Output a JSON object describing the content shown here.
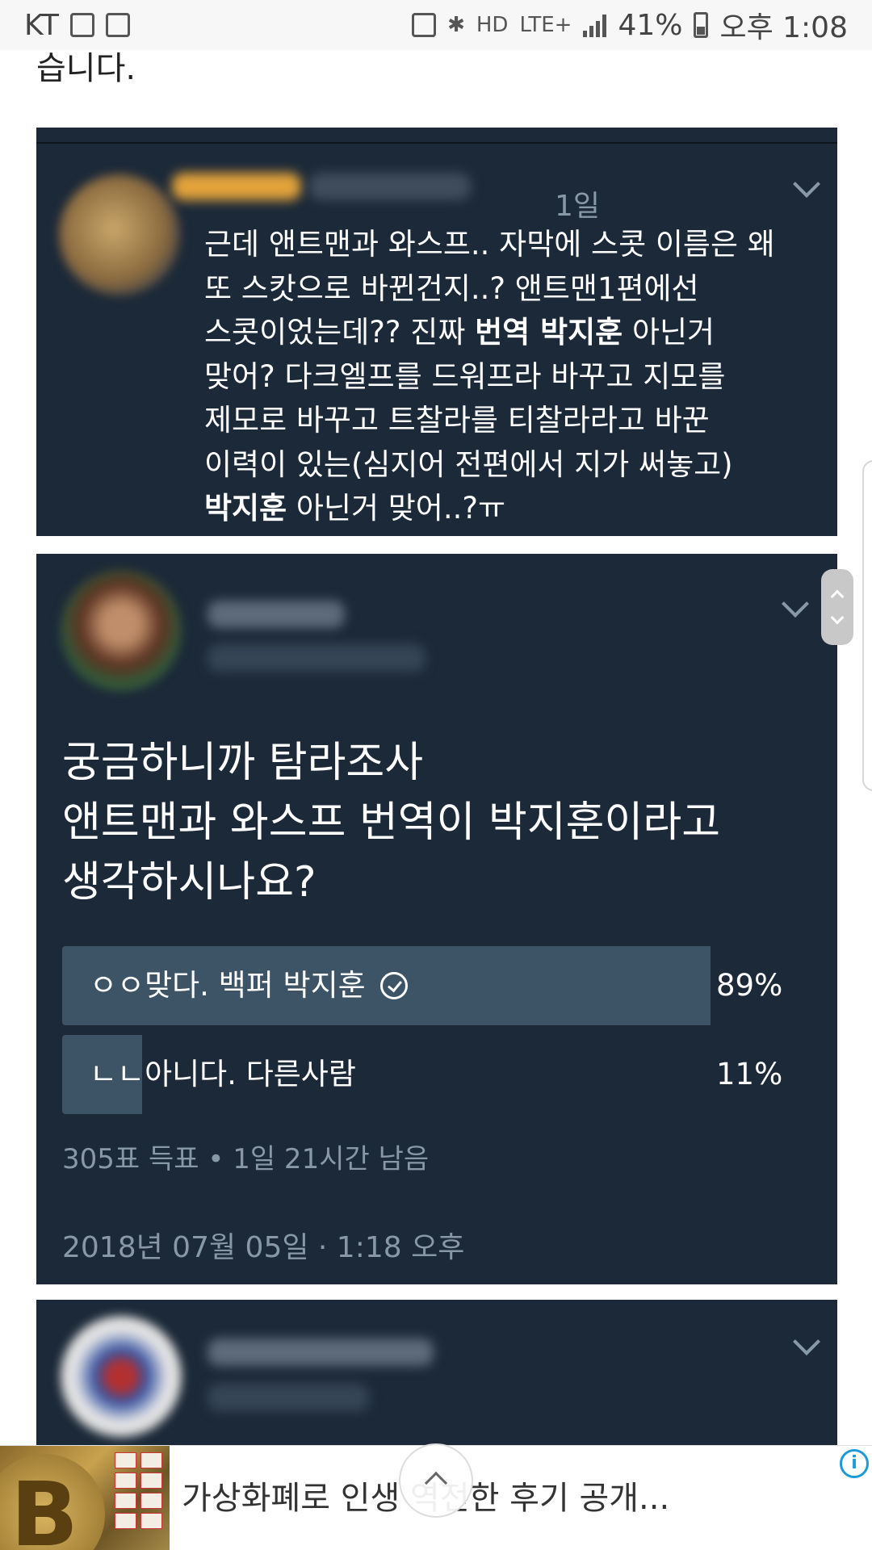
{
  "status_bar": {
    "carrier": "KT",
    "network": "LTE+",
    "hd_label": "HD",
    "battery": "41%",
    "time": "오후 1:08"
  },
  "top_text": "습니다.",
  "tweet1": {
    "time": "1일",
    "lines": [
      {
        "text": "근데 앤트맨과 와스프.. 자막에 스콧 이름은 왜"
      },
      {
        "text": "또 스캇으로 바뀐건지..? 앤트맨1편에선"
      },
      {
        "pre": "스콧이었는데?? 진짜 ",
        "bold": "번역 박지훈",
        "post": " 아닌거"
      },
      {
        "text": "맞어? 다크엘프를 드워프라 바꾸고 지모를"
      },
      {
        "text": "제모로 바꾸고 트찰라를 티찰라라고 바꾼"
      },
      {
        "text": "이력이 있는(심지어 전편에서 지가 써놓고)"
      },
      {
        "bold": "박지훈",
        "post": " 아닌거 맞어..?ㅠ"
      }
    ]
  },
  "tweet2": {
    "question_lines": [
      "궁금하니까 탐라조사",
      "앤트맨과 와스프 번역이 박지훈이라고",
      "생각하시나요?"
    ],
    "options": [
      {
        "label": "ㅇㅇ맞다. 백퍼 박지훈",
        "percent": "89%",
        "fraction": 0.89,
        "selected": true
      },
      {
        "label": "ㄴㄴ아니다. 다른사람",
        "percent": "11%",
        "fraction": 0.11,
        "selected": false
      }
    ],
    "poll_meta": "305표 득표 • 1일 21시간  남음",
    "date": "2018년 07월 05일 · 1:18 오후"
  },
  "ad": {
    "text": "가상화폐로 인생 역전한 후기 공개...",
    "thumb_symbol": "B",
    "info_symbol": "i"
  },
  "colors": {
    "card_bg": "#1c2938",
    "poll_fill": "#3d5466",
    "muted_text": "#8899a6"
  }
}
